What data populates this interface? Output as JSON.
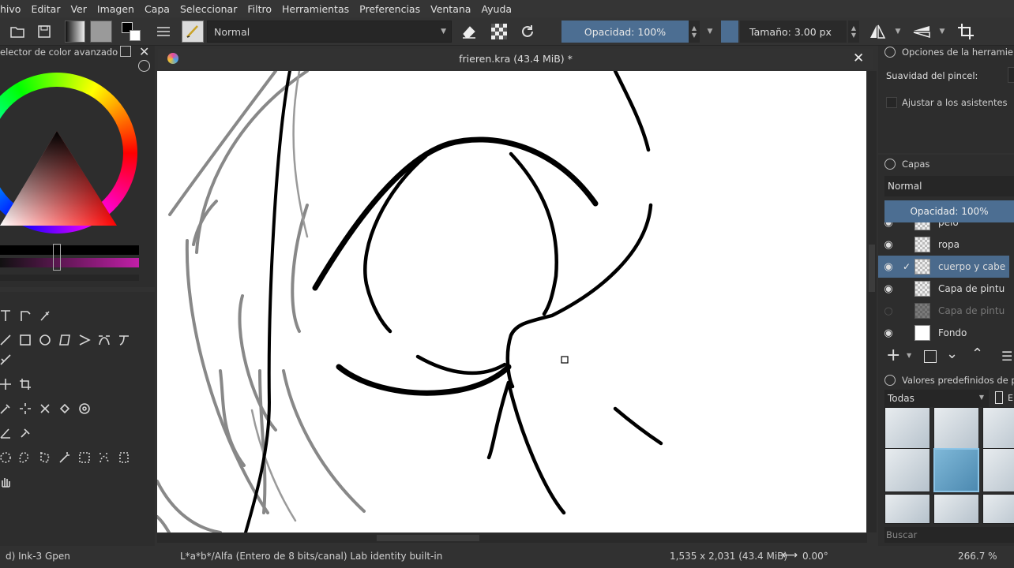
{
  "menu": [
    "hivo",
    "Editar",
    "Ver",
    "Imagen",
    "Capa",
    "Seleccionar",
    "Filtro",
    "Herramientas",
    "Preferencias",
    "Ventana",
    "Ayuda"
  ],
  "toolbar": {
    "blend_mode": "Normal",
    "opacity": "Opacidad: 100%",
    "size": "Tamaño: 3.00 px"
  },
  "color_docker": {
    "title": "elector de color avanzado"
  },
  "document": {
    "title": "frieren.kra (43.4 MiB) *"
  },
  "tool_options": {
    "title": "Opciones de la herramient",
    "smoothing_label": "Suavidad del pincel:",
    "snap_label": "Ajustar a los asistentes"
  },
  "layers": {
    "title": "Capas",
    "blend_mode": "Normal",
    "opacity": "Opacidad:  100%",
    "items": [
      {
        "name": "pelo",
        "visible": true,
        "selected": false
      },
      {
        "name": "ropa",
        "visible": true,
        "selected": false
      },
      {
        "name": "cuerpo y cabe",
        "visible": true,
        "selected": true
      },
      {
        "name": "Capa de pintu",
        "visible": true,
        "selected": false
      },
      {
        "name": "Capa de pintu",
        "visible": false,
        "selected": false
      },
      {
        "name": "Fondo",
        "visible": true,
        "selected": false
      }
    ]
  },
  "presets": {
    "title": "Valores predefinidos de pi",
    "filter": "Todas",
    "tag_label": "E",
    "search_placeholder": "Buscar"
  },
  "status": {
    "brush": "d) Ink-3 Gpen",
    "color_space": "L*a*b*/Alfa (Entero de 8 bits/canal)  Lab identity built-in",
    "dimensions": "1,535 x 2,031 (43.4 MiB)",
    "rotation": "0.00°",
    "zoom": "266.7 %"
  },
  "colors": {
    "accent": "#4c6e92",
    "selected_layer": "#4a6a8c",
    "panel": "#2d2d2d",
    "canvas": "#ffffff"
  }
}
